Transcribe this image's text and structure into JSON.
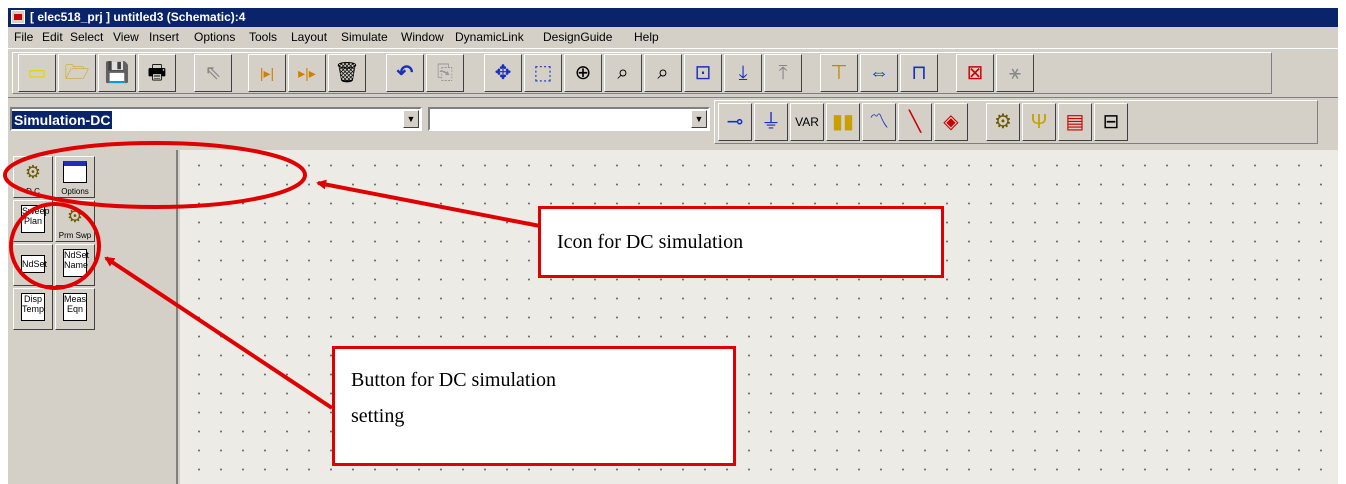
{
  "window": {
    "title": "[ elec518_prj ] untitled3 (Schematic):4"
  },
  "menu": [
    "File",
    "Edit",
    "Select",
    "View",
    "Insert",
    "Options",
    "Tools",
    "Layout",
    "Simulate",
    "Window",
    "DynamicLink",
    "DesignGuide",
    "Help"
  ],
  "toolbar": {
    "component_combo_value": "Simulation-DC",
    "component_search_value": ""
  },
  "palette": {
    "items": [
      {
        "icon": "gear-icon",
        "label": "D C"
      },
      {
        "icon": "options-icon",
        "label": "Options"
      },
      {
        "icon": "sweep-plan-icon",
        "icon_text": "Sweep Plan",
        "label": ""
      },
      {
        "icon": "gear-icon",
        "label": "Prm Swp"
      },
      {
        "icon": "ndset-icon",
        "icon_text": "NdSet",
        "label": ""
      },
      {
        "icon": "ndset-name-icon",
        "icon_text": "NdSet Name",
        "label": ""
      },
      {
        "icon": "disp-temp-icon",
        "icon_text": "Disp Temp",
        "label": ""
      },
      {
        "icon": "meas-eqn-icon",
        "icon_text": "Meas Eqn",
        "label": ""
      }
    ]
  },
  "annotations": {
    "icon_callout": "Icon for DC simulation",
    "button_callout_line1": "Button for DC simulation",
    "button_callout_line2": "setting",
    "color": "#e00000"
  }
}
